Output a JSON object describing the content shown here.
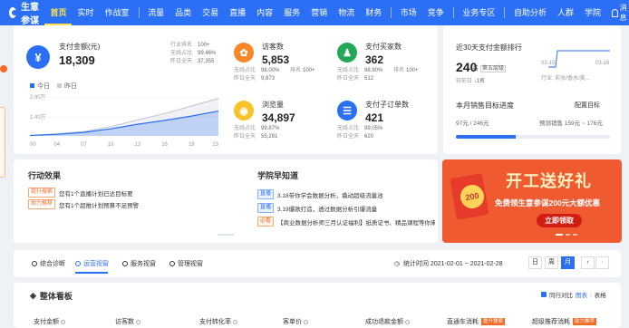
{
  "nav": {
    "logo": "生意参谋",
    "items": [
      "首页",
      "实时",
      "作战室",
      "流量",
      "品类",
      "交易",
      "直播",
      "内容",
      "服务",
      "营销",
      "物流",
      "财务",
      "市场",
      "竞争",
      "业务专区",
      "自助分析",
      "人群",
      "学院"
    ],
    "messages": "消息"
  },
  "main": {
    "pay_amount": {
      "label": "支付金额(元)",
      "value": "18,309",
      "rank_label": "行业排名",
      "rank_value": "100+",
      "wireless_label": "无线占比",
      "wireless_value": "99.46%",
      "yesterday_label": "昨日全天",
      "yesterday_value": "37,355"
    },
    "visitors": {
      "label": "访客数",
      "value": "5,853",
      "wireless_label": "无线占比",
      "wireless_value": "98.00%",
      "rank_label": "排名",
      "rank_value": "100+",
      "yesterday_label": "昨日全天",
      "yesterday_value": "9,873"
    },
    "buyers": {
      "label": "支付买家数",
      "value": "362",
      "wireless_label": "无线占比",
      "wireless_value": "98.90%",
      "rank_label": "排名",
      "rank_value": "100+",
      "yesterday_label": "昨日全天",
      "yesterday_value": "512"
    },
    "pageviews": {
      "label": "浏览量",
      "value": "34,897",
      "wireless_label": "无线占比",
      "wireless_value": "99.87%",
      "yesterday_label": "昨日全天",
      "yesterday_value": "55,291"
    },
    "sub_orders": {
      "label": "支付子订单数",
      "value": "421",
      "wireless_label": "无线占比",
      "wireless_value": "99.05%",
      "yesterday_label": "昨日全天",
      "yesterday_value": "620"
    },
    "legend_today": "今日",
    "legend_yesterday": "昨日"
  },
  "chart_data": {
    "type": "area",
    "x": [
      "00",
      "04",
      "07",
      "10",
      "13",
      "16",
      "19",
      "23"
    ],
    "ylabels": [
      "2.80万",
      "1.40万",
      "0"
    ],
    "ylim": [
      0,
      28000
    ],
    "series": [
      {
        "name": "今日",
        "values": [
          300,
          1200,
          2600,
          5200,
          8600,
          11400,
          14600,
          18300
        ],
        "color": "#2b6ff5"
      },
      {
        "name": "昨日",
        "values": [
          400,
          1500,
          3200,
          6800,
          11800,
          16400,
          22000,
          27500
        ],
        "color": "#c7ccd6"
      }
    ]
  },
  "rank": {
    "title": "近30天支付金额排行",
    "value": "240",
    "unit": "名",
    "level": "第五层级",
    "sub": "较前日",
    "change": "1名",
    "date_start": "02-15",
    "date_end": "03-16",
    "industry": "行业: 彩妆/香水/美...",
    "target_title": "本月销售目标进度",
    "target_set": "配置目标",
    "target_left": "97元 / 246元",
    "target_right": "预测销售 159元 ~ 176元",
    "progress": 0.39
  },
  "activity": {
    "title": "行动效果",
    "rows": [
      {
        "tag": "提升搜索",
        "text": "您有1个直播计划已达目标要"
      },
      {
        "tag": "助力推荐",
        "text": "您有1个超推计划预算不足预警"
      }
    ]
  },
  "school": {
    "title": "学院早知道",
    "rows": [
      {
        "tag": "直播",
        "text": "3.18带你学会数据分析，撬动超级流量池"
      },
      {
        "tag": "直播",
        "text": "3.19爆款打造，透过数据分析引爆流量"
      },
      {
        "tag": "必看",
        "text": "【商业数据分析师三月认证福利】纸质证书、精品课程等你来"
      }
    ]
  },
  "banner": {
    "title": "开工送好礼",
    "subtitle": "免费领生意参谋200元大额优惠",
    "button": "立即领取",
    "coin": "200"
  },
  "view_tabs": {
    "tabs": [
      "综合诊断",
      "运营视窗",
      "服务视窗",
      "管理视窗"
    ],
    "period_label": "统计时间",
    "period": "2021-02-01 ~ 2021-02-28",
    "buttons": [
      "日",
      "周",
      "月"
    ]
  },
  "board": {
    "title": "整体看板",
    "compare": "同行对比",
    "view_chart": "图表",
    "view_table": "表格",
    "columns": [
      "支付金额",
      "访客数",
      "支付转化率",
      "客单价",
      "成功退款金额",
      "直通车消耗",
      "超级推荐消耗"
    ],
    "tags": [
      "提升搜索",
      "助力推荐"
    ]
  }
}
